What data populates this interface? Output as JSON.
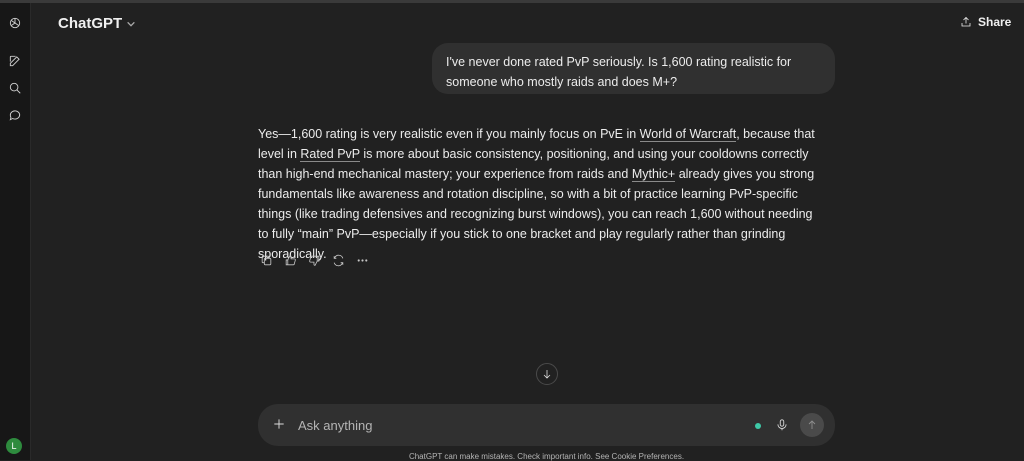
{
  "header": {
    "model_name": "ChatGPT",
    "share_label": "Share"
  },
  "user_message": "I've never done rated PvP seriously. Is 1,600 rating realistic for someone who mostly raids and does M+?",
  "answer": {
    "p1": "Yes—1,600 rating is very realistic even if you mainly focus on PvE in ",
    "link1": "World of Warcraft",
    "p2": ", because that level in ",
    "link2": "Rated PvP",
    "p3": " is more about basic consistency, positioning, and using your cooldowns correctly than high-end mechanical mastery; your experience from raids and ",
    "link3": "Mythic+",
    "p4": " already gives you strong fundamentals like awareness and rotation discipline, so with a bit of practice learning PvP-specific things (like trading defensives and recognizing burst windows), you can reach 1,600 without needing to fully “main” PvP—especially if you stick to one bracket and play regularly rather than grinding sporadically."
  },
  "composer": {
    "placeholder": "Ask anything"
  },
  "disclaimer": "ChatGPT can make mistakes. Check important info. See Cookie Preferences.",
  "user": {
    "avatar_initial": "L"
  },
  "icons": {
    "rail": [
      "openai-logo-icon",
      "new-chat-icon",
      "search-icon",
      "chat-bubble-icon"
    ],
    "actions": [
      "copy-icon",
      "thumbs-up-icon",
      "thumbs-down-icon",
      "regenerate-icon",
      "more-icon"
    ]
  },
  "colors": {
    "background": "#212121",
    "sidebar": "#171717",
    "bubble": "#303030",
    "voice_dot": "#3ec9a7",
    "avatar": "#2e8b3e"
  }
}
